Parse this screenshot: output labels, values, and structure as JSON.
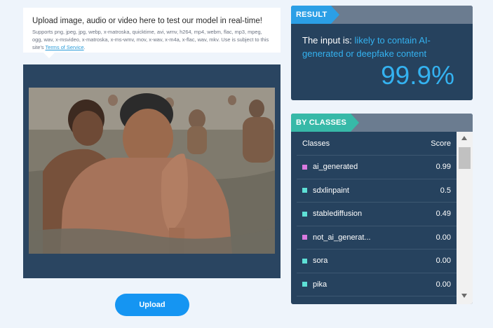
{
  "upload_info": {
    "headline": "Upload image, audio or video here to test our model in real-time!",
    "supported": "Supports png, jpeg, jpg, webp, x-matroska, quicktime, avi, wmv, h264, mp4, webm, flac, mp3, mpeg, ogg, wav, x-msvideo, x-matroska, x-ms-wmv, mov, x-wav, x-m4a, x-flac, wav, mkv. Use is subject to this site's",
    "tos_link": "Terms of Service",
    "tos_suffix": "."
  },
  "upload_button": {
    "label": "Upload"
  },
  "result": {
    "tag": "RESULT",
    "prefix": "The input is: ",
    "verdict": "likely to contain AI-generated or deepfake content",
    "score": "99.9%",
    "accent_color": "#34b2f0"
  },
  "classes": {
    "tag": "BY CLASSES",
    "columns": {
      "name": "Classes",
      "score": "Score"
    },
    "rows": [
      {
        "name": "ai_generated",
        "score": "0.99",
        "color": "#d97ae0"
      },
      {
        "name": "sdxlinpaint",
        "score": "0.5",
        "color": "#5ee0d6"
      },
      {
        "name": "stablediffusion",
        "score": "0.49",
        "color": "#5ee0d6"
      },
      {
        "name": "not_ai_generat...",
        "score": "0.00",
        "color": "#d97ae0"
      },
      {
        "name": "sora",
        "score": "0.00",
        "color": "#5ee0d6"
      },
      {
        "name": "pika",
        "score": "0.00",
        "color": "#5ee0d6"
      }
    ]
  }
}
